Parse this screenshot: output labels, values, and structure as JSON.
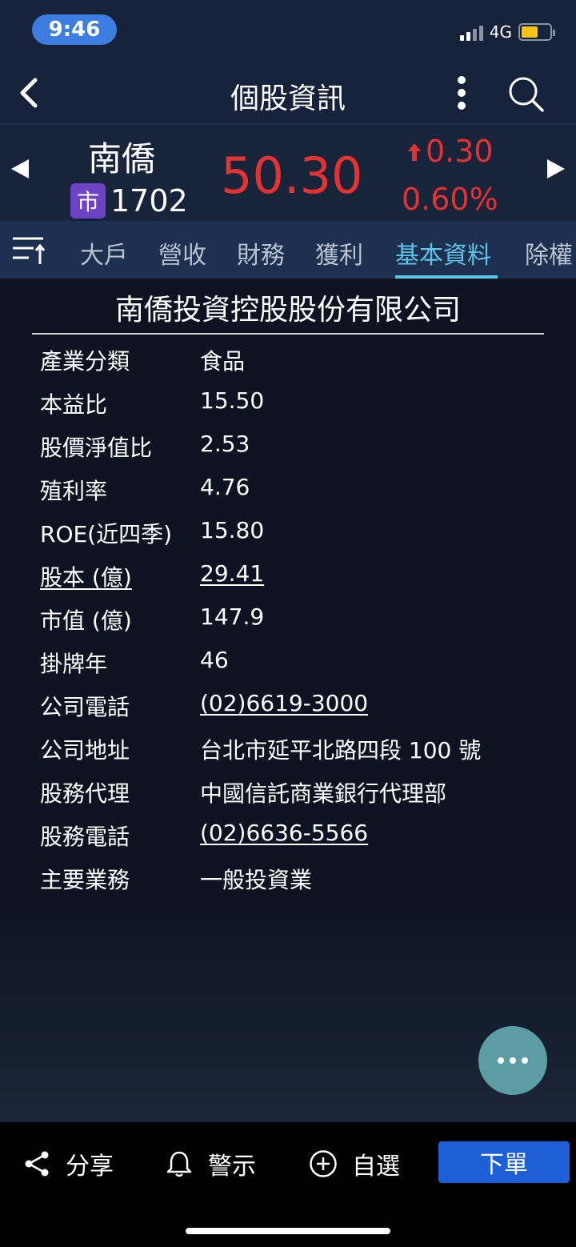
{
  "status_bar": {
    "time": "9:46",
    "network": "4G"
  },
  "header": {
    "title": "個股資訊"
  },
  "stock": {
    "name": "南僑",
    "market_badge": "市",
    "code": "1702",
    "price": "50.30",
    "change": "0.30",
    "change_pct": "0.60%",
    "price_color": "#e43232"
  },
  "tabs": [
    {
      "label": "大戶"
    },
    {
      "label": "營收"
    },
    {
      "label": "財務"
    },
    {
      "label": "獲利"
    },
    {
      "label": "基本資料",
      "active": true
    },
    {
      "label": "除權"
    }
  ],
  "company": {
    "full_name": "南僑投資控股股份有限公司",
    "rows": [
      {
        "label": "產業分類",
        "value": "食品"
      },
      {
        "label": "本益比",
        "value": "15.50"
      },
      {
        "label": "股價淨值比",
        "value": "2.53"
      },
      {
        "label": "殖利率",
        "value": "4.76"
      },
      {
        "label": "ROE(近四季)",
        "value": "15.80"
      },
      {
        "label": "股本 (億)",
        "value": "29.41"
      },
      {
        "label": "市值 (億)",
        "value": "147.9"
      },
      {
        "label": "掛牌年",
        "value": "46"
      },
      {
        "label": "公司電話",
        "value": "(02)6619-3000"
      },
      {
        "label": "公司地址",
        "value": "台北市延平北路四段 100 號"
      },
      {
        "label": "股務代理",
        "value": "中國信託商業銀行代理部"
      },
      {
        "label": "股務電話",
        "value": "(02)6636-5566"
      },
      {
        "label": "主要業務",
        "value": "一般投資業"
      }
    ]
  },
  "bottom_bar": {
    "share_label": "分享",
    "alert_label": "警示",
    "watchlist_label": "自選",
    "order_label": "下單"
  },
  "colors": {
    "accent": "#5fc3e8",
    "up": "#e43232",
    "order_button": "#1f5fd6",
    "fab": "#5b9da3"
  },
  "icons": [
    "back-icon",
    "more-icon",
    "search-icon",
    "sort-icon",
    "share-icon",
    "bell-icon",
    "add-circle-icon"
  ]
}
